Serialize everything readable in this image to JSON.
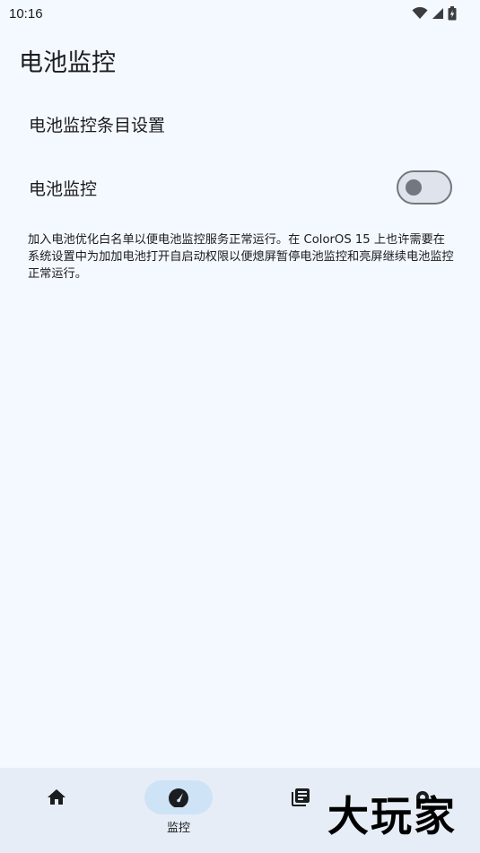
{
  "status_bar": {
    "time": "10:16",
    "icons": [
      "wifi-icon",
      "cellular-icon",
      "battery-charging-icon"
    ]
  },
  "page": {
    "title": "电池监控"
  },
  "settings": {
    "items_label": "电池监控条目设置",
    "monitor_label": "电池监控",
    "monitor_enabled": false
  },
  "description": "加入电池优化白名单以便电池监控服务正常运行。在 ColorOS 15 上也许需要在系统设置中为加加电池打开自启动权限以便熄屏暂停电池监控和亮屏继续电池监控正常运行。",
  "bottom_nav": {
    "items": [
      {
        "icon": "home-icon",
        "label": ""
      },
      {
        "icon": "speedometer-icon",
        "label": "监控",
        "active": true
      },
      {
        "icon": "library-icon",
        "label": ""
      },
      {
        "icon": "settings-icon",
        "label": ""
      }
    ]
  },
  "watermark": "大玩家",
  "colors": {
    "background": "#F4F9FF",
    "nav_background": "#E6EDF6",
    "active_pill": "#CFE3F7",
    "toggle_outline": "#73777F"
  }
}
